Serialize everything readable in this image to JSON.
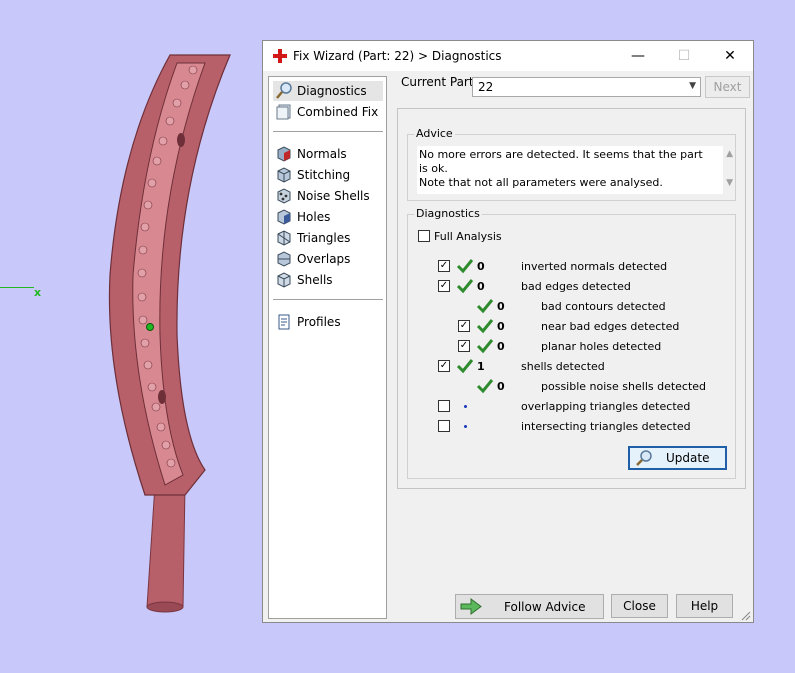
{
  "viewport": {
    "axis_label": "x"
  },
  "window": {
    "title": "Fix Wizard (Part: 22) > Diagnostics",
    "minimize": "—",
    "maximize": "☐",
    "close": "✕"
  },
  "nav": {
    "items": [
      {
        "label": "Diagnostics",
        "icon": "magnifier-icon",
        "selected": true
      },
      {
        "label": "Combined Fix",
        "icon": "combined-fix-icon"
      },
      {
        "label": "Normals",
        "icon": "normals-cube-icon"
      },
      {
        "label": "Stitching",
        "icon": "stitching-icon"
      },
      {
        "label": "Noise Shells",
        "icon": "noise-shells-icon"
      },
      {
        "label": "Holes",
        "icon": "holes-icon"
      },
      {
        "label": "Triangles",
        "icon": "triangles-icon"
      },
      {
        "label": "Overlaps",
        "icon": "overlaps-icon"
      },
      {
        "label": "Shells",
        "icon": "shells-icon"
      },
      {
        "label": "Profiles",
        "icon": "profiles-icon"
      }
    ]
  },
  "current_part": {
    "label": "Current Part:",
    "value": "22",
    "next_label": "Next"
  },
  "advice": {
    "title": "Advice",
    "text": "No more errors are detected. It seems that the part is ok.\nNote that not all parameters were analysed."
  },
  "diagnostics": {
    "title": "Diagnostics",
    "full_analysis": "Full Analysis",
    "rows": [
      {
        "checked": true,
        "ok": true,
        "count": "0",
        "label": "inverted normals detected"
      },
      {
        "checked": true,
        "ok": true,
        "count": "0",
        "label": "bad edges detected"
      },
      {
        "checked": null,
        "ok": true,
        "count": "0",
        "label": "bad contours detected"
      },
      {
        "checked": true,
        "ok": true,
        "count": "0",
        "label": "near bad edges detected"
      },
      {
        "checked": true,
        "ok": true,
        "count": "0",
        "label": "planar holes detected"
      },
      {
        "checked": true,
        "ok": true,
        "count": "1",
        "label": "shells detected"
      },
      {
        "checked": null,
        "ok": true,
        "count": "0",
        "label": "possible noise shells detected"
      },
      {
        "checked": false,
        "ok": false,
        "count": "",
        "label": "overlapping triangles detected"
      },
      {
        "checked": false,
        "ok": false,
        "count": "",
        "label": "intersecting triangles detected"
      }
    ],
    "update_label": "Update"
  },
  "footer": {
    "follow_advice": "Follow Advice",
    "close": "Close",
    "help": "Help"
  },
  "colors": {
    "check_green": "#2e8b2e",
    "part_red": "#b8606a",
    "background": "#c8c8fa"
  }
}
